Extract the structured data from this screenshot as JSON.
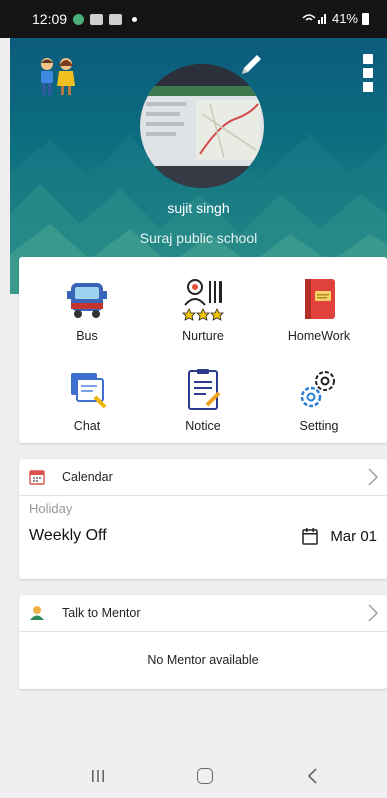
{
  "status_bar": {
    "time": "12:09",
    "battery": "41%"
  },
  "profile": {
    "name": "sujit singh",
    "school": "Suraj public school"
  },
  "tiles": [
    {
      "label": "Bus",
      "icon": "bus-icon"
    },
    {
      "label": "Nurture",
      "icon": "nurture-icon"
    },
    {
      "label": "HomeWork",
      "icon": "homework-icon"
    },
    {
      "label": "Chat",
      "icon": "chat-icon"
    },
    {
      "label": "Notice",
      "icon": "notice-icon"
    },
    {
      "label": "Setting",
      "icon": "setting-icon"
    }
  ],
  "calendar": {
    "title": "Calendar",
    "section_label": "Holiday",
    "event": "Weekly Off",
    "date": "Mar 01"
  },
  "mentor": {
    "title": "Talk to Mentor",
    "empty_message": "No Mentor available"
  },
  "colors": {
    "header_top": "#0c5b7d",
    "header_bottom": "#2f9487",
    "background": "#efefef"
  }
}
